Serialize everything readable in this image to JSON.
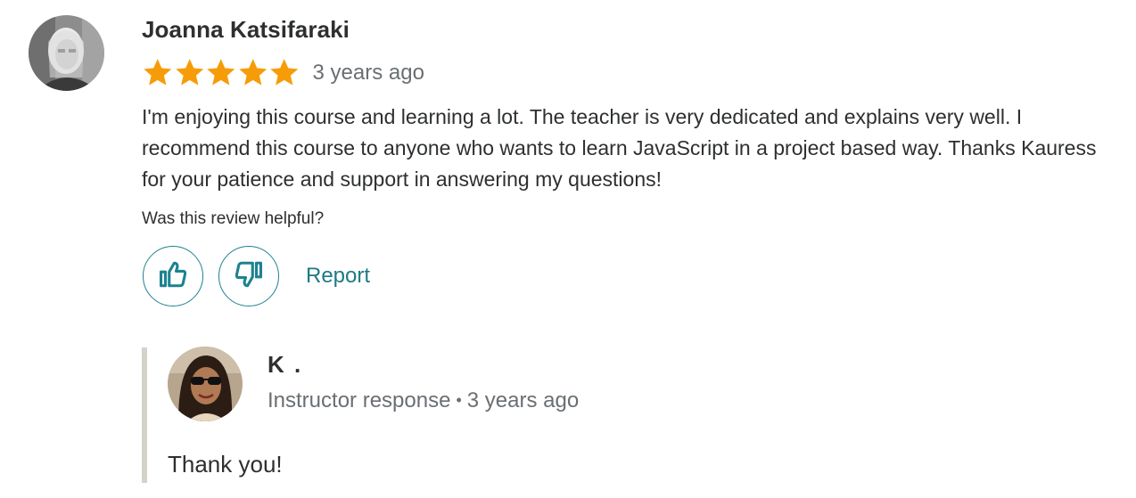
{
  "review": {
    "reviewer_name": "Joanna Katsifaraki",
    "rating": 5,
    "rating_max": 5,
    "date": "3 years ago",
    "text": "I'm enjoying this course and learning a lot. The teacher is very dedicated and explains very well. I recommend this course to anyone who wants to learn JavaScript in a project based way. Thanks Kauress for your patience and support in answering my questions!",
    "star_color": "#f69c08",
    "helpful_question": "Was this review helpful?",
    "thumbs_up_icon": "thumbs-up-icon",
    "thumbs_down_icon": "thumbs-down-icon",
    "report_label": "Report",
    "accent_color": "#1e8290"
  },
  "response": {
    "instructor_name": "K .",
    "role_label": "Instructor response",
    "separator": "•",
    "date": "3 years ago",
    "text": "Thank you!"
  }
}
